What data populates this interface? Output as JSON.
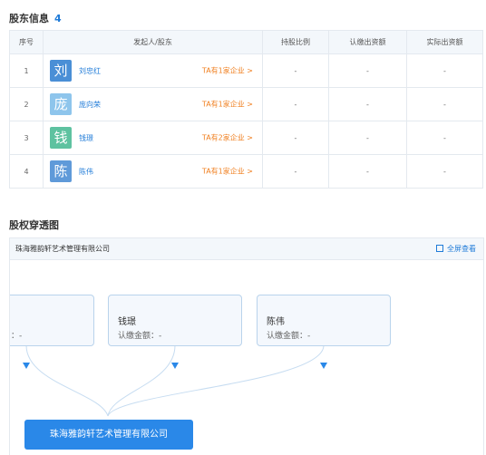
{
  "shareholders": {
    "title": "股东信息",
    "count": "4",
    "columns": [
      "序号",
      "发起人/股东",
      "持股比例",
      "认缴出资额",
      "实际出资额"
    ],
    "rows": [
      {
        "index": "1",
        "avatar_char": "刘",
        "avatar_color": "#4a8fd6",
        "name": "刘忠红",
        "ta_text": "TA有1家企业 >",
        "ratio": "-",
        "subscribed": "-",
        "paid": "-"
      },
      {
        "index": "2",
        "avatar_char": "庞",
        "avatar_color": "#8ec5ec",
        "name": "庞向荣",
        "ta_text": "TA有1家企业 >",
        "ratio": "-",
        "subscribed": "-",
        "paid": "-"
      },
      {
        "index": "3",
        "avatar_char": "钱",
        "avatar_color": "#5ec2a0",
        "name": "钱璟",
        "ta_text": "TA有2家企业 >",
        "ratio": "-",
        "subscribed": "-",
        "paid": "-"
      },
      {
        "index": "4",
        "avatar_char": "陈",
        "avatar_color": "#5f9ad9",
        "name": "陈伟",
        "ta_text": "TA有1家企业 >",
        "ratio": "-",
        "subscribed": "-",
        "paid": "-"
      }
    ]
  },
  "equity": {
    "title": "股权穿透图",
    "company": "珠海雅韵轩艺术管理有限公司",
    "fullscreen_label": "全屏查看",
    "nodes": [
      {
        "name": "",
        "amount": "：-"
      },
      {
        "name": "钱璟",
        "amount": "认缴金额：-"
      },
      {
        "name": "陈伟",
        "amount": "认缴金额：-"
      }
    ],
    "target": "珠海雅韵轩艺术管理有限公司"
  },
  "colors": {
    "accent": "#1f7bd8",
    "link_orange": "#f07f1f",
    "header_bg": "#f3f7fb"
  }
}
